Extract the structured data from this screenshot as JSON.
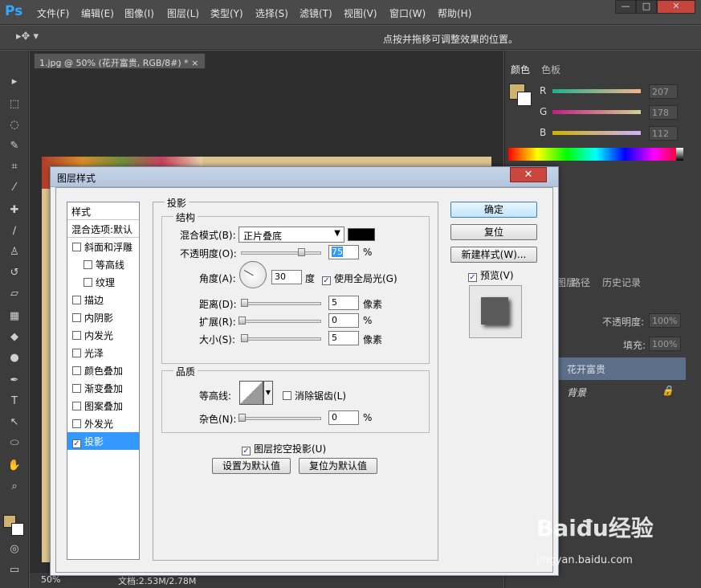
{
  "app": {
    "logo": "Ps"
  },
  "menubar": {
    "items": [
      "文件(F)",
      "编辑(E)",
      "图像(I)",
      "图层(L)",
      "类型(Y)",
      "选择(S)",
      "滤镜(T)",
      "视图(V)",
      "窗口(W)",
      "帮助(H)"
    ],
    "win_min": "—",
    "win_max": "□",
    "win_close": "✕"
  },
  "optionsbar": {
    "hint": "点按并拖移可调整效果的位置。"
  },
  "document": {
    "tab_title": "1.jpg @ 50% (花开富贵, RGB/8#) *",
    "tab_close": "×"
  },
  "statusbar": {
    "zoom": "50%",
    "doc_info": "文档:2.53M/2.78M"
  },
  "color_panel": {
    "tabs": [
      "颜色",
      "色板"
    ],
    "channels": [
      {
        "label": "R",
        "value": "207",
        "color": "#cf0000"
      },
      {
        "label": "G",
        "value": "178",
        "color": "#00b200"
      },
      {
        "label": "B",
        "value": "112",
        "color": "#0070ff"
      }
    ],
    "foreground": "#cfb270"
  },
  "layers_panel": {
    "tabs": [
      "图层",
      "路径",
      "历史记录"
    ],
    "opacity_label": "不透明度:",
    "opacity_value": "100%",
    "fill_label": "填充:",
    "fill_value": "100%",
    "layers": [
      "花开富贵",
      "背景"
    ]
  },
  "dialog": {
    "title": "图层样式",
    "close": "✕",
    "styles_header": "样式",
    "blend_header": "混合选项:默认",
    "styles": [
      {
        "label": "斜面和浮雕",
        "checked": false,
        "indent": false
      },
      {
        "label": "等高线",
        "checked": false,
        "indent": true
      },
      {
        "label": "纹理",
        "checked": false,
        "indent": true
      },
      {
        "label": "描边",
        "checked": false,
        "indent": false
      },
      {
        "label": "内阴影",
        "checked": false,
        "indent": false
      },
      {
        "label": "内发光",
        "checked": false,
        "indent": false
      },
      {
        "label": "光泽",
        "checked": false,
        "indent": false
      },
      {
        "label": "颜色叠加",
        "checked": false,
        "indent": false
      },
      {
        "label": "渐变叠加",
        "checked": false,
        "indent": false
      },
      {
        "label": "图案叠加",
        "checked": false,
        "indent": false
      },
      {
        "label": "外发光",
        "checked": false,
        "indent": false
      },
      {
        "label": "投影",
        "checked": true,
        "indent": false
      }
    ],
    "section_title": "投影",
    "structure": {
      "title": "结构",
      "blend_mode_label": "混合模式(B):",
      "blend_mode_value": "正片叠底",
      "shadow_color": "#000000",
      "opacity_label": "不透明度(O):",
      "opacity_value": "75",
      "opacity_pct": 0.75,
      "percent": "%",
      "angle_label": "角度(A):",
      "angle_value": "30",
      "angle_unit": "度",
      "global_light_label": "使用全局光(G)",
      "global_light_checked": true,
      "distance_label": "距离(D):",
      "distance_value": "5",
      "spread_label": "扩展(R):",
      "spread_value": "0",
      "size_label": "大小(S):",
      "size_value": "5",
      "pixel_unit": "像素"
    },
    "quality": {
      "title": "品质",
      "contour_label": "等高线:",
      "antialias_label": "消除锯齿(L)",
      "noise_label": "杂色(N):",
      "noise_value": "0"
    },
    "knockout_label": "图层挖空投影(U)",
    "set_default": "设置为默认值",
    "reset_default": "复位为默认值",
    "ok": "确定",
    "reset": "复位",
    "new_style": "新建样式(W)...",
    "preview_label": "预览(V)"
  },
  "watermark": {
    "text": "Baiđu经验",
    "url": "jingyan.baidu.com"
  }
}
